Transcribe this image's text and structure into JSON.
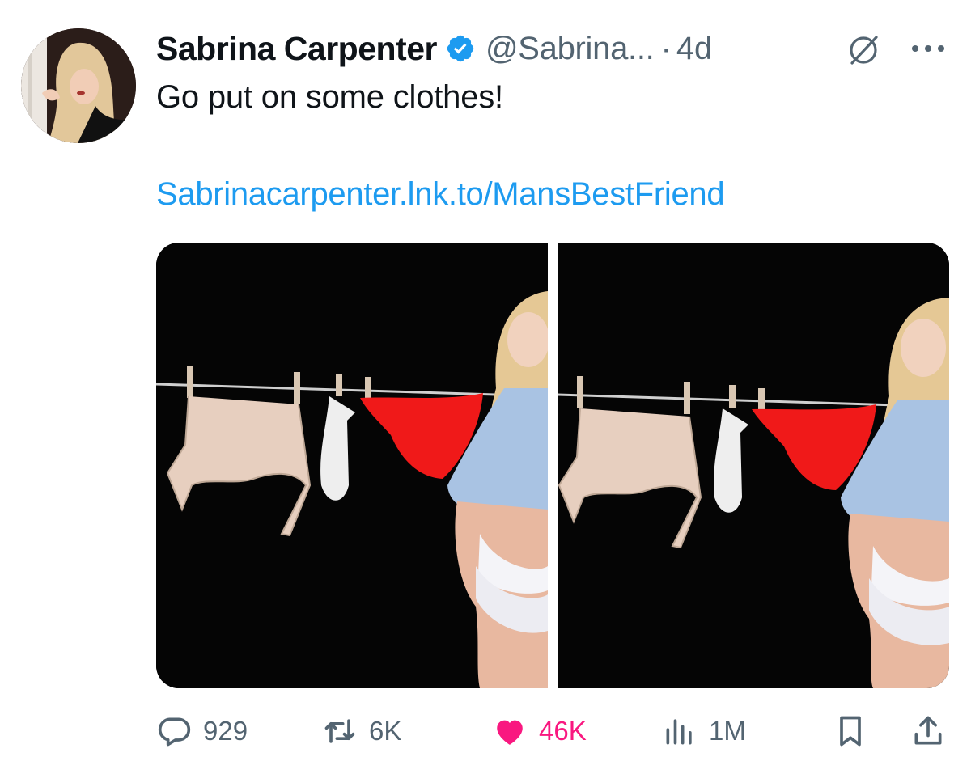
{
  "tweet": {
    "display_name": "Sabrina Carpenter",
    "handle": "@Sabrina...",
    "separator": "·",
    "timestamp": "4d",
    "text": "Go put on some clothes!",
    "link": "Sabrinacarpenter.lnk.to/MansBestFriend"
  },
  "icons": {
    "verified": "verified-badge-icon",
    "grok": "grok-icon",
    "more": "more-icon",
    "reply": "reply-icon",
    "retweet": "retweet-icon",
    "like": "like-icon",
    "views": "views-icon",
    "bookmark": "bookmark-icon",
    "share": "share-icon"
  },
  "actions": {
    "replies": "929",
    "retweets": "6K",
    "likes": "46K",
    "views": "1M"
  },
  "colors": {
    "link": "#1d9bf0",
    "verified": "#1d9bf0",
    "like": "#f91880",
    "muted": "#536471",
    "text": "#0f1419"
  }
}
